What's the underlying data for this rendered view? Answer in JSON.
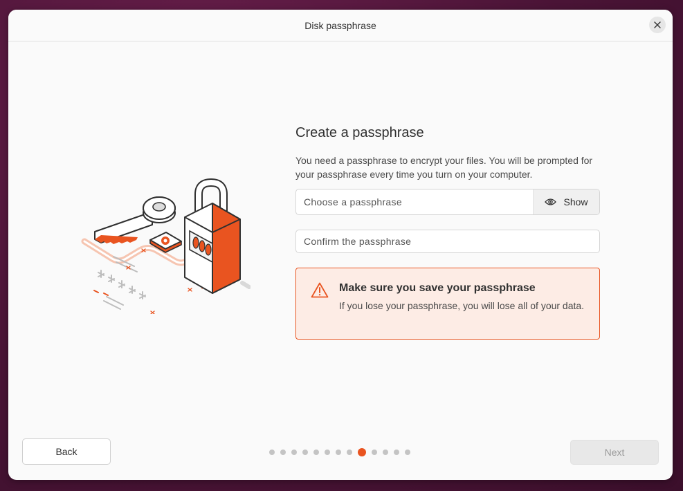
{
  "window": {
    "title": "Disk passphrase"
  },
  "main": {
    "heading": "Create a passphrase",
    "description": "You need a passphrase to encrypt your files. You will be prompted for your passphrase every time you turn on your computer.",
    "passphrase": {
      "placeholder": "Choose a passphrase",
      "value": "",
      "show_label": "Show"
    },
    "confirm": {
      "placeholder": "Confirm the passphrase",
      "value": ""
    },
    "warning": {
      "title": "Make sure you save your passphrase",
      "text": "If you lose your passphrase, you will lose all of your data."
    }
  },
  "footer": {
    "back_label": "Back",
    "next_label": "Next",
    "pager": {
      "total": 13,
      "current": 9
    }
  },
  "colors": {
    "accent": "#E95420",
    "warning_bg": "#FDECE5",
    "disabled_text": "#9A9A9A"
  },
  "icons": [
    "close-icon",
    "eye-icon",
    "warning-icon",
    "key-lock-illustration"
  ]
}
